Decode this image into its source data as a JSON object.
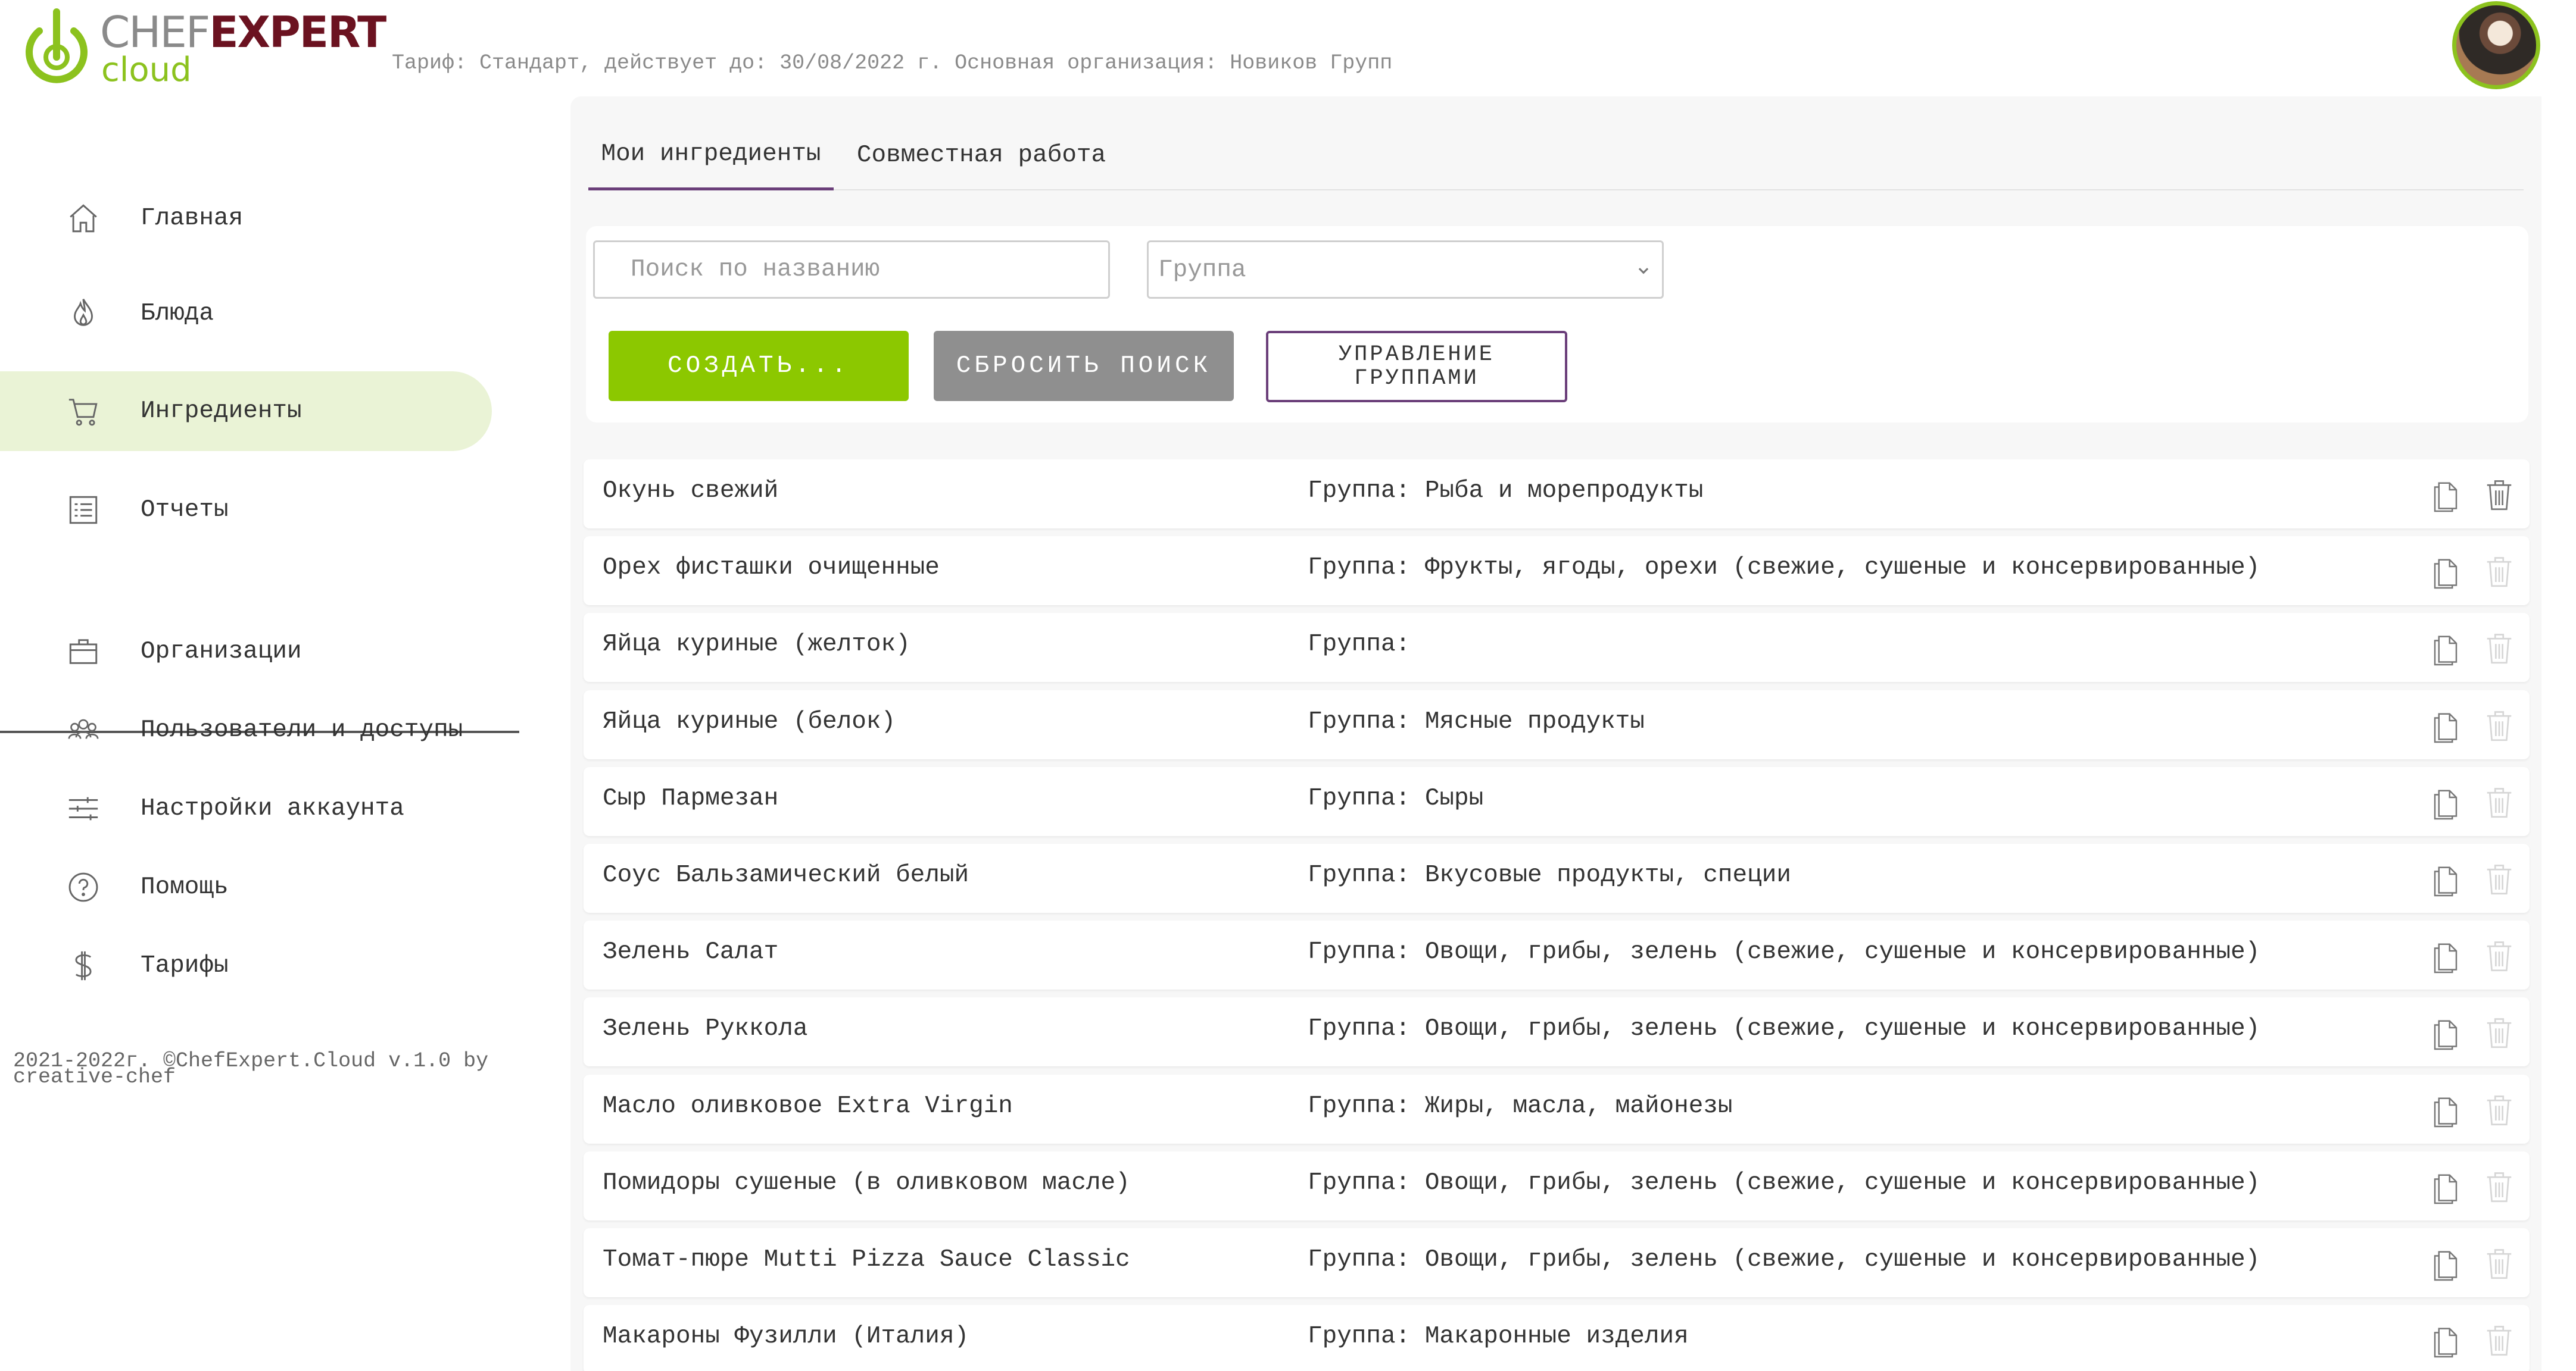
{
  "app": {
    "logo_chef": "CHEF",
    "logo_expert": "EXPERT",
    "logo_cloud": "cloud",
    "tariff_text": "Тариф: Стандарт, действует до: 30/08/2022 г. Основная организация: Новиков Групп",
    "accent_green": "#8cc800",
    "accent_purple": "#6b3f7a"
  },
  "sidebar": {
    "items": [
      {
        "label": "Главная",
        "icon": "home-icon"
      },
      {
        "label": "Блюда",
        "icon": "flame-icon"
      },
      {
        "label": "Ингредиенты",
        "icon": "cart-icon",
        "active": true
      },
      {
        "label": "Отчеты",
        "icon": "list-icon"
      },
      {
        "label": "Организации",
        "icon": "briefcase-icon"
      },
      {
        "label": "Пользователи и доступы",
        "icon": "users-icon"
      },
      {
        "label": "Настройки аккаунта",
        "icon": "sliders-icon"
      },
      {
        "label": "Помощь",
        "icon": "help-icon"
      },
      {
        "label": "Тарифы",
        "icon": "dollar-icon"
      }
    ],
    "footer": "2021-2022г. ©ChefExpert.Cloud v.1.0 by creative-chef"
  },
  "tabs": [
    {
      "label": "Мои ингредиенты",
      "active": true
    },
    {
      "label": "Совместная работа",
      "active": false
    }
  ],
  "filters": {
    "search_placeholder": "Поиск по названию",
    "group_placeholder": "Группа",
    "create_label": "СОЗДАТЬ...",
    "reset_label": "СБРОСИТЬ ПОИСК",
    "manage_line1": "УПРАВЛЕНИЕ",
    "manage_line2": "ГРУППАМИ"
  },
  "ingredients": [
    {
      "name": "Окунь свежий",
      "group": "Группа: Рыба и морепродукты"
    },
    {
      "name": "Орех фисташки очищенные",
      "group": "Группа: Фрукты, ягоды, орехи (свежие, сушеные и консервированные)"
    },
    {
      "name": "Яйца куриные (желток)",
      "group": "Группа:"
    },
    {
      "name": "Яйца куриные (белок)",
      "group": "Группа: Мясные продукты"
    },
    {
      "name": "Сыр Пармезан",
      "group": "Группа: Сыры"
    },
    {
      "name": "Соус Бальзамический белый",
      "group": "Группа: Вкусовые продукты, специи"
    },
    {
      "name": "Зелень Салат",
      "group": "Группа: Овощи, грибы, зелень (свежие, сушеные и консервированные)"
    },
    {
      "name": "Зелень Руккола",
      "group": "Группа: Овощи, грибы, зелень (свежие, сушеные и консервированные)"
    },
    {
      "name": "Масло оливковое Extra Virgin",
      "group": "Группа: Жиры, масла, майонезы"
    },
    {
      "name": "Помидоры сушеные (в оливковом масле)",
      "group": "Группа: Овощи, грибы, зелень (свежие, сушеные и консервированные)"
    },
    {
      "name": "Томат-пюре Mutti Pizza Sauce Classic",
      "group": "Группа: Овощи, грибы, зелень (свежие, сушеные и консервированные)"
    },
    {
      "name": "Макароны Фузилли (Италия)",
      "group": "Группа: Макаронные изделия"
    }
  ]
}
